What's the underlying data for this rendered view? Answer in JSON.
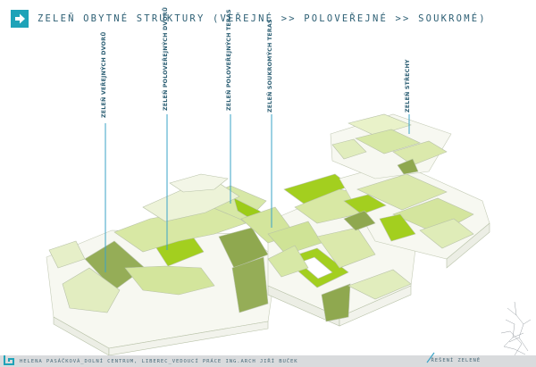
{
  "header": {
    "title": "ZELEŇ OBYTNÉ STRUKTURY (VEŘEJNÉ >> POLOVEŘEJNÉ >> SOUKROMÉ)"
  },
  "labels": [
    {
      "id": "public-courtyards",
      "text": "ZELEŇ VEŘEJNÝCH DVORŮ"
    },
    {
      "id": "semipublic-courtyards",
      "text": "ZELEŇ POLOVEŘEJNÝCH DVORŮ"
    },
    {
      "id": "semipublic-terraces",
      "text": "ZELEŇ POLOVEŘEJNÝCH TERAS"
    },
    {
      "id": "private-terraces",
      "text": "ZELEŇ SOUKROMÝCH TERAS"
    },
    {
      "id": "roofs",
      "text": "ZELEŇ STŘECHY"
    }
  ],
  "footer": {
    "left": "HELENA PASÁČKOVÁ_DOLNÍ CENTRUM, LIBEREC_VEDOUCÍ PRÁCE ING.ARCH JIŘÍ BUČEK",
    "right": "ŘEŠENÍ ZELENĚ"
  },
  "colors": {
    "accent": "#1fa3b8",
    "leader_line": "#3aa3c7",
    "green_light": "#e9f2c9",
    "green_mid": "#cfe396",
    "green_bright": "#a3cf1f",
    "green_dark": "#8fa84f",
    "wall": "#f4f5ef"
  }
}
